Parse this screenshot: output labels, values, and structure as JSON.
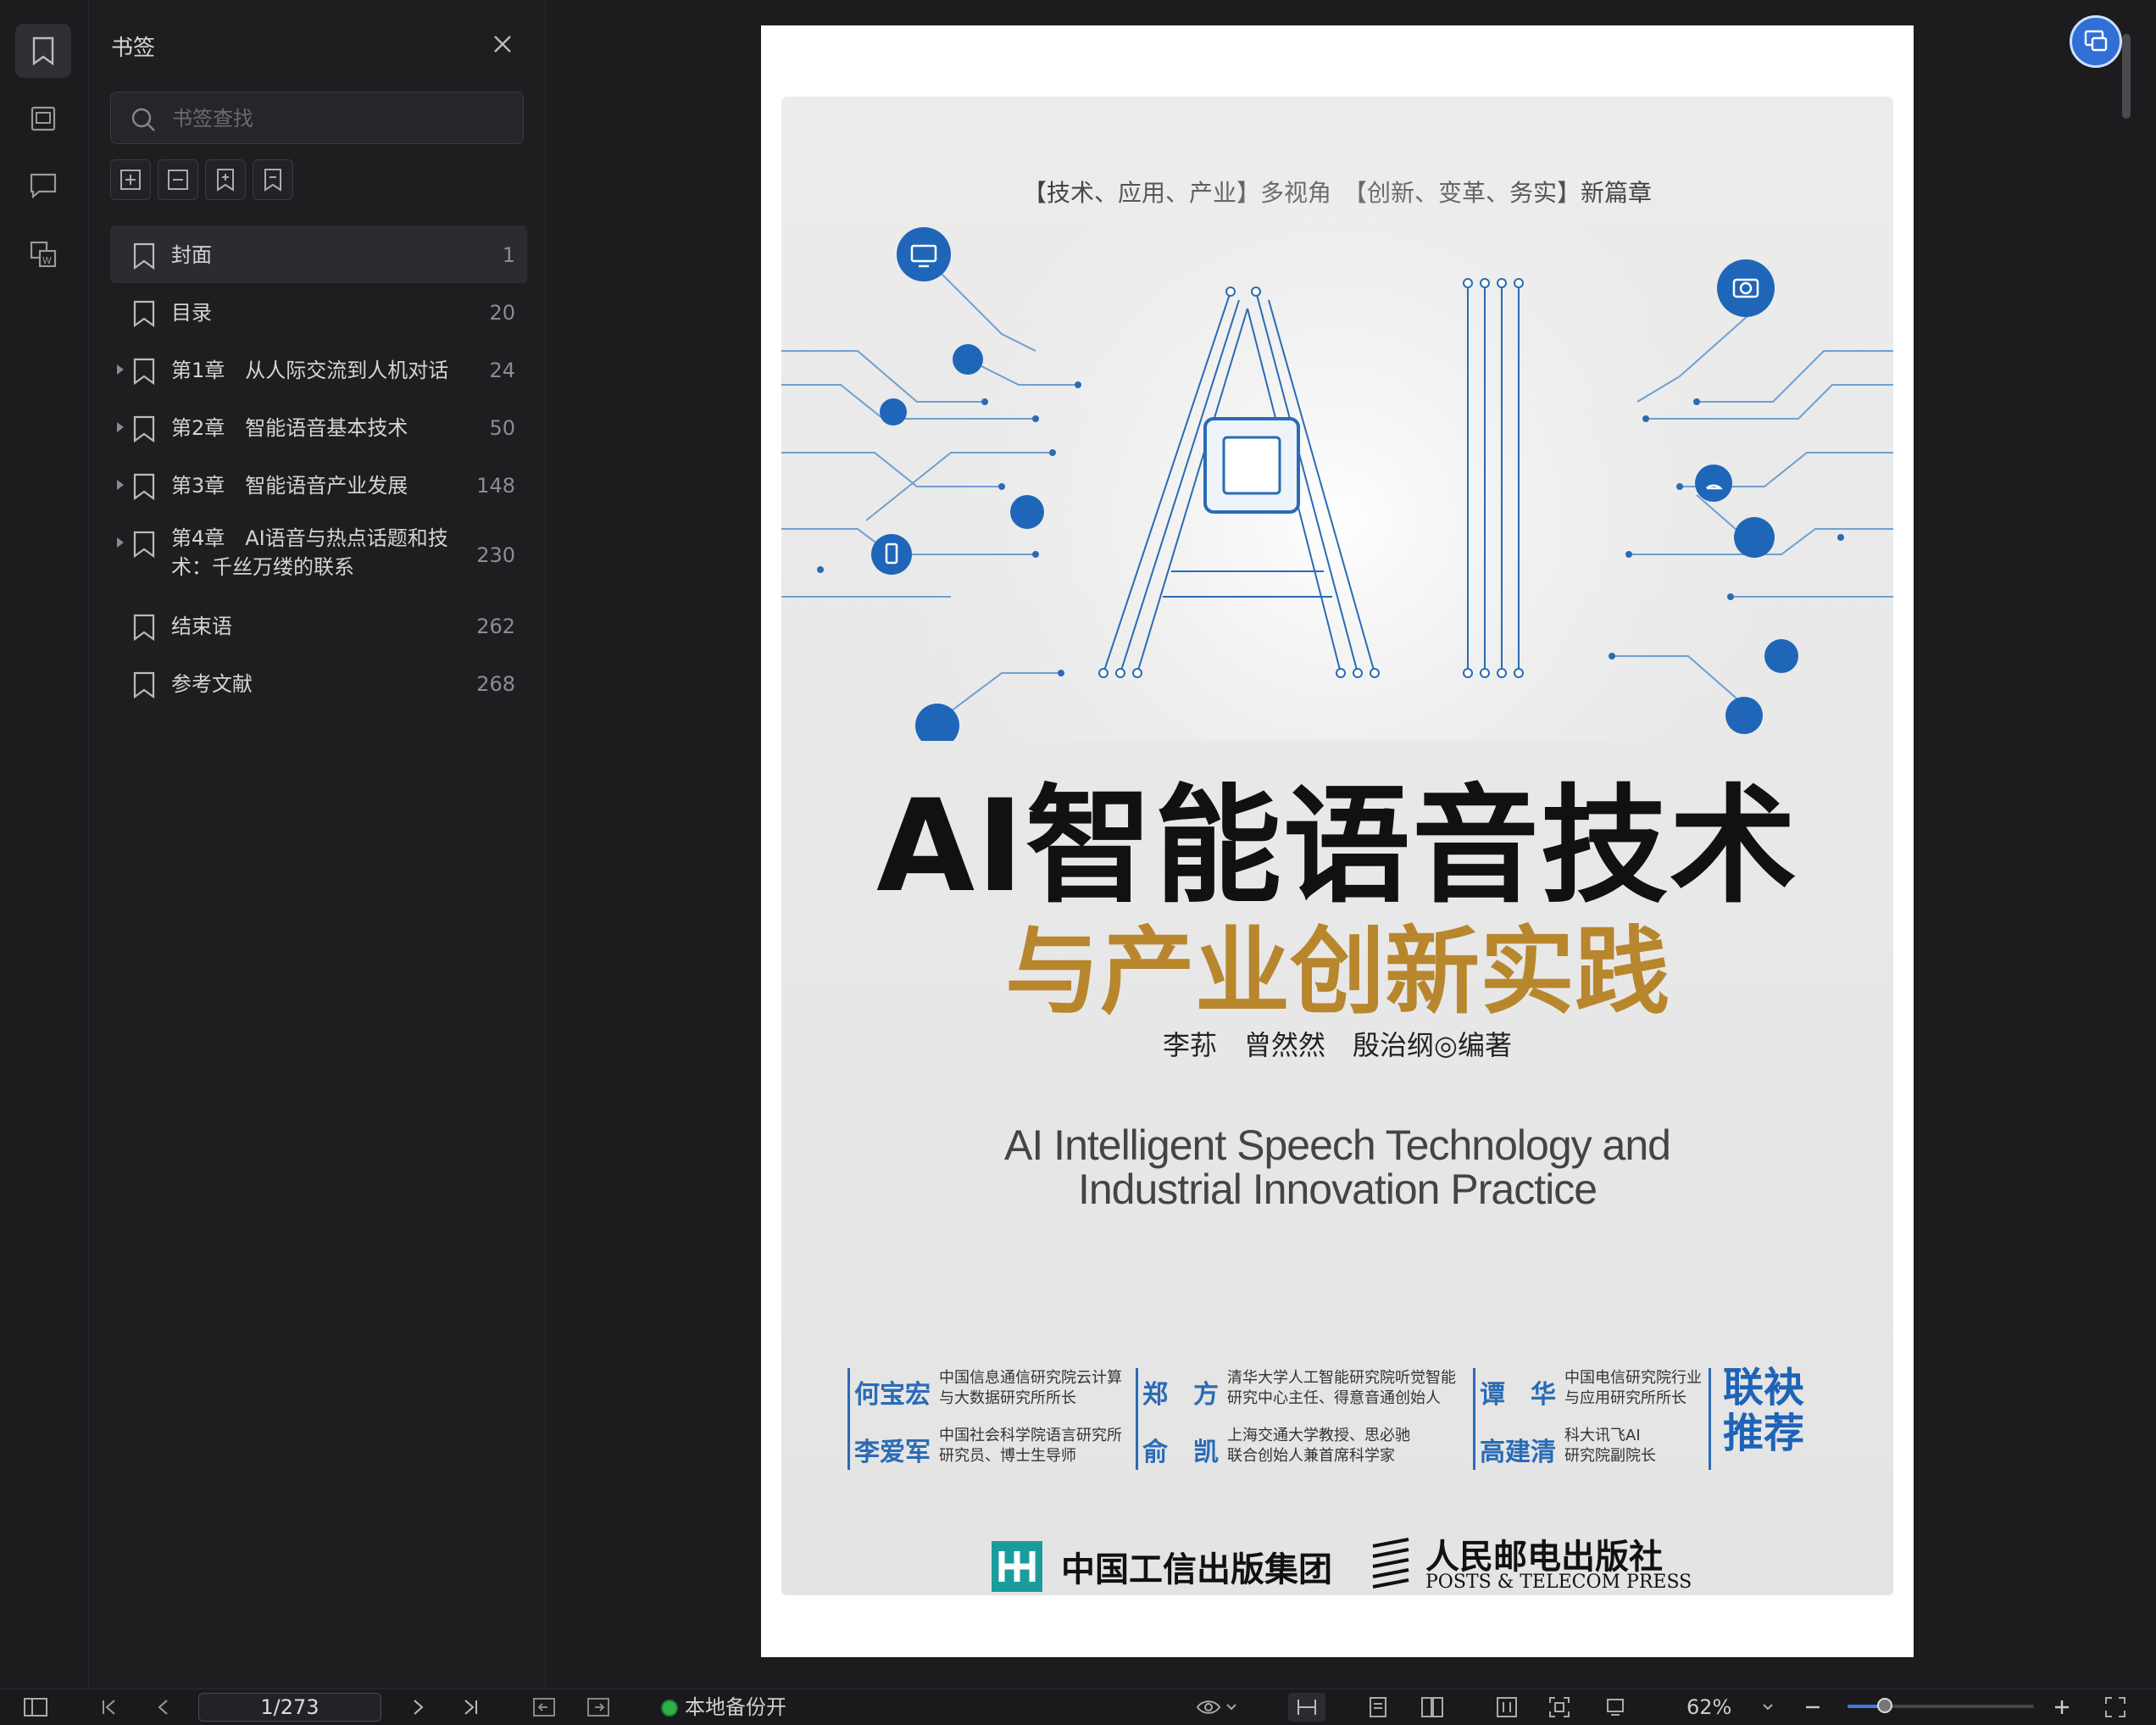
{
  "panel": {
    "title": "书签",
    "search_placeholder": "书签查找"
  },
  "bookmarks": [
    {
      "label": "封面",
      "page": "1",
      "expandable": false,
      "selected": true
    },
    {
      "label": "目录",
      "page": "20",
      "expandable": false,
      "selected": false
    },
    {
      "label": "第1章　从人际交流到人机对话",
      "page": "24",
      "expandable": true,
      "selected": false
    },
    {
      "label": "第2章　智能语音基本技术",
      "page": "50",
      "expandable": true,
      "selected": false
    },
    {
      "label": "第3章　智能语音产业发展",
      "page": "148",
      "expandable": true,
      "selected": false
    },
    {
      "label": "第4章　AI语音与热点话题和技术：千丝万缕的联系",
      "page": "230",
      "expandable": true,
      "selected": false
    },
    {
      "label": "结束语",
      "page": "262",
      "expandable": false,
      "selected": false
    },
    {
      "label": "参考文献",
      "page": "268",
      "expandable": false,
      "selected": false
    }
  ],
  "cover": {
    "tagline": "【技术、应用、产业】多视角　【创新、变革、务实】新篇章",
    "big_letters": "AI",
    "title_main": "AI智能语音技术",
    "title_sub": "与产业创新实践",
    "authors": "李荪　曾然然　殷治纲◎编著",
    "english_line1": "AI Intelligent Speech Technology and",
    "english_line2": "Industrial Innovation Practice",
    "recommenders": [
      {
        "name": "何宝宏",
        "desc1": "中国信息通信研究院云计算",
        "desc2": "与大数据研究所所长"
      },
      {
        "name": "郑　方",
        "desc1": "清华大学人工智能研究院听觉智能",
        "desc2": "研究中心主任、得意音通创始人"
      },
      {
        "name": "谭　华",
        "desc1": "中国电信研究院行业",
        "desc2": "与应用研究所所长"
      },
      {
        "name": "李爱军",
        "desc1": "中国社会科学院语言研究所",
        "desc2": "研究员、博士生导师"
      },
      {
        "name": "俞　凯",
        "desc1": "上海交通大学教授、思必驰",
        "desc2": "联合创始人兼首席科学家"
      },
      {
        "name": "高建清",
        "desc1": "科大讯飞AI",
        "desc2": "研究院副院长"
      }
    ],
    "joint_recommend_1": "联袂",
    "joint_recommend_2": "推荐",
    "publisher1": "中国工信出版集团",
    "publisher2": "人民邮电出版社",
    "publisher2_en": "POSTS & TELECOM PRESS"
  },
  "toolbar": {
    "page_indicator": "1/273",
    "backup_status": "本地备份开",
    "zoom": "62%",
    "zoom_fraction": 0.2
  },
  "colors": {
    "accent": "#3d7be0",
    "title_gold": "#b8862d",
    "cover_blue": "#1e63b8",
    "backup_green": "#2db24a"
  }
}
